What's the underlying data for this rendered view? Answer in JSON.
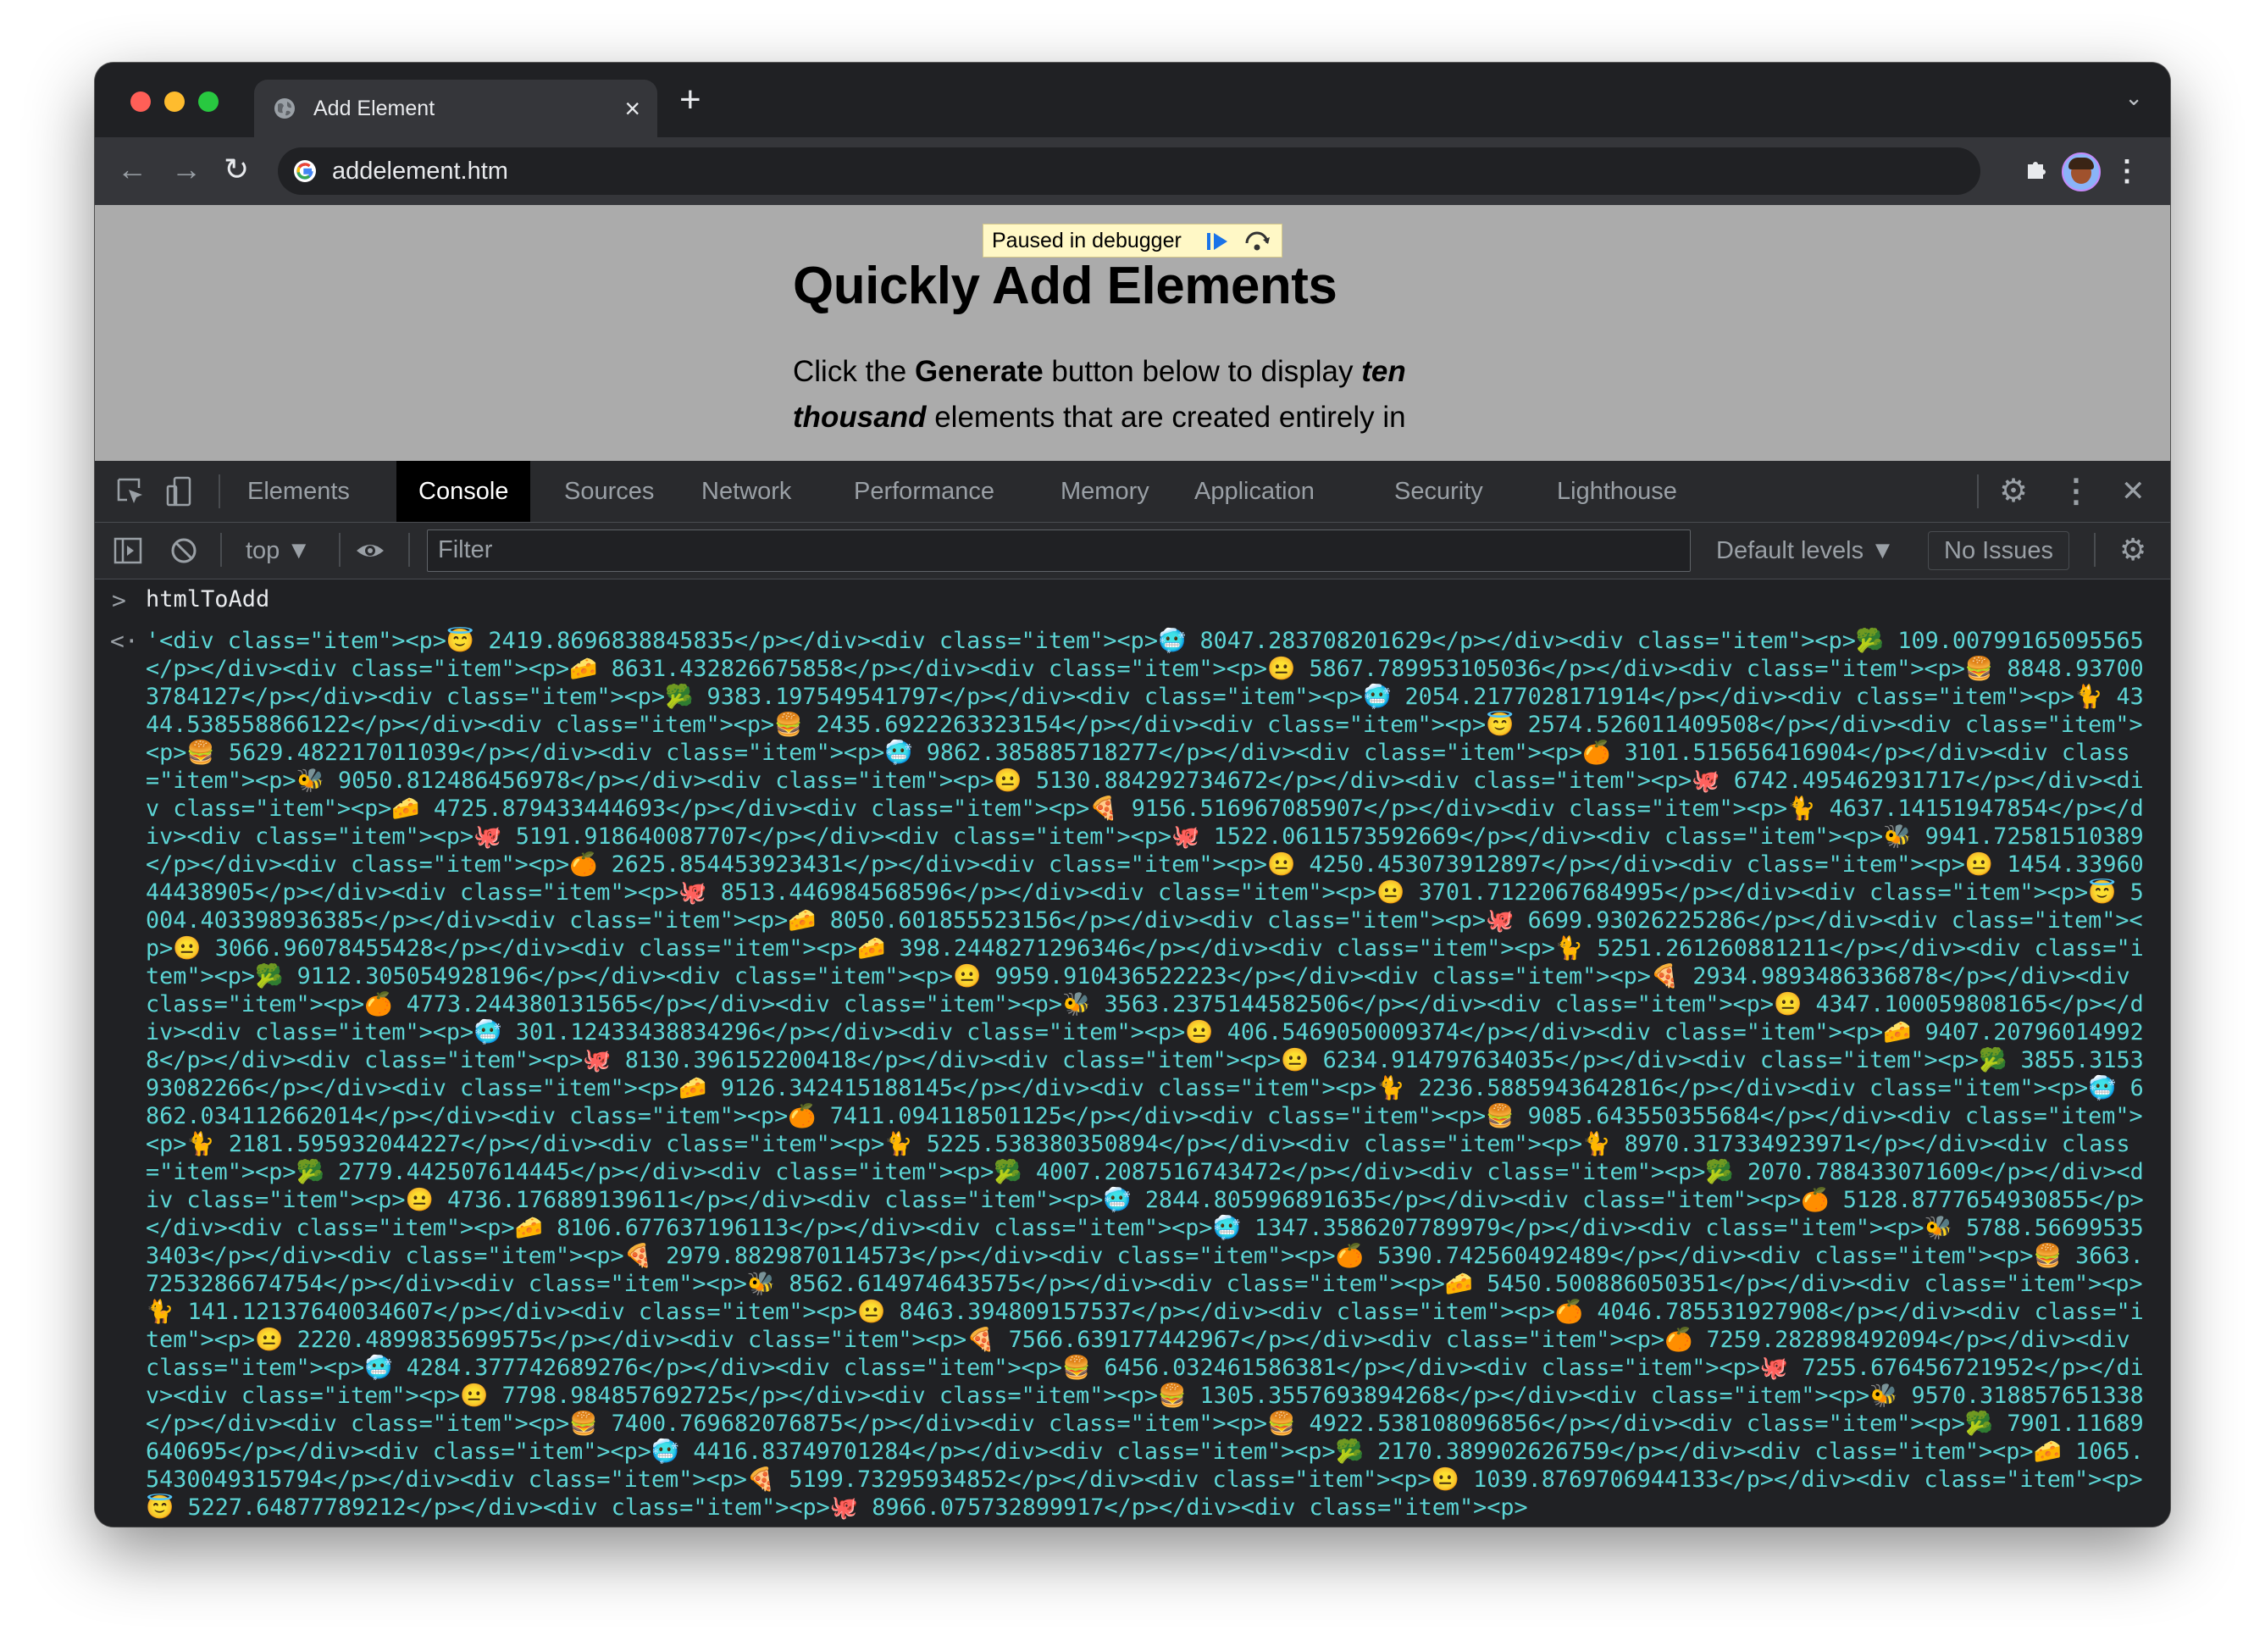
{
  "browser": {
    "tab_title": "Add Element",
    "tab_close": "×",
    "new_tab": "+",
    "tab_search": "⌄",
    "url": "addelement.htm",
    "nav_back": "←",
    "nav_forward": "→",
    "nav_reload": "↻",
    "menu": "⋮"
  },
  "page": {
    "debugger_banner": "Paused in debugger",
    "title": "Quickly Add Elements",
    "para_prefix": "Click the ",
    "para_bold": "Generate",
    "para_mid": " button below to display ",
    "para_em": "ten thousand",
    "para_suffix": " elements that are created entirely in"
  },
  "devtools": {
    "tabs": [
      "Elements",
      "Console",
      "Sources",
      "Network",
      "Performance",
      "Memory",
      "Application",
      "Security",
      "Lighthouse"
    ],
    "active_tab": "Console",
    "settings": "⚙",
    "more": "⋮",
    "close": "✕",
    "context": "top ▼",
    "filter_placeholder": "Filter",
    "levels": "Default levels ▼",
    "issues": "No Issues"
  },
  "console": {
    "input_prompt": ">",
    "input_command": "htmlToAdd",
    "output_prompt": "<·",
    "output_text": "'<div class=\"item\"><p>😇 2419.8696838845835</p></div><div class=\"item\"><p>🥶 8047.283708201629</p></div><div class=\"item\"><p>🥦 109.00799165095565</p></div><div class=\"item\"><p>🧀 8631.432826675858</p></div><div class=\"item\"><p>😐 5867.789953105036</p></div><div class=\"item\"><p>🍔 8848.937003784127</p></div><div class=\"item\"><p>🥦 9383.197549541797</p></div><div class=\"item\"><p>🥶 2054.2177028171914</p></div><div class=\"item\"><p>🐈 4344.538558866122</p></div><div class=\"item\"><p>🍔 2435.6922263323154</p></div><div class=\"item\"><p>😇 2574.526011409508</p></div><div class=\"item\"><p>🍔 5629.482217011039</p></div><div class=\"item\"><p>🥶 9862.385885718277</p></div><div class=\"item\"><p>🍊 3101.515656416904</p></div><div class=\"item\"><p>🐝 9050.812486456978</p></div><div class=\"item\"><p>😐 5130.884292734672</p></div><div class=\"item\"><p>🐙 6742.495462931717</p></div><div class=\"item\"><p>🧀 4725.879433444693</p></div><div class=\"item\"><p>🍕 9156.516967085907</p></div><div class=\"item\"><p>🐈 4637.14151947854</p></div><div class=\"item\"><p>🐙 5191.918640087707</p></div><div class=\"item\"><p>🐙 1522.0611573592669</p></div><div class=\"item\"><p>🐝 9941.72581510389</p></div><div class=\"item\"><p>🍊 2625.854453923431</p></div><div class=\"item\"><p>😐 4250.453073912897</p></div><div class=\"item\"><p>😐 1454.3396044438905</p></div><div class=\"item\"><p>🐙 8513.446984568596</p></div><div class=\"item\"><p>😐 3701.7122067684995</p></div><div class=\"item\"><p>😇 5004.403398936385</p></div><div class=\"item\"><p>🧀 8050.601855523156</p></div><div class=\"item\"><p>🐙 6699.93026225286</p></div><div class=\"item\"><p>😐 3066.96078455428</p></div><div class=\"item\"><p>🧀 398.2448271296346</p></div><div class=\"item\"><p>🐈 5251.261260881211</p></div><div class=\"item\"><p>🥦 9112.305054928196</p></div><div class=\"item\"><p>😐 9959.910436522223</p></div><div class=\"item\"><p>🍕 2934.9893486336878</p></div><div class=\"item\"><p>🍊 4773.244380131565</p></div><div class=\"item\"><p>🐝 3563.2375144582506</p></div><div class=\"item\"><p>😐 4347.100059808165</p></div><div class=\"item\"><p>🥶 301.12433438834296</p></div><div class=\"item\"><p>😐 406.5469050009374</p></div><div class=\"item\"><p>🧀 9407.207960149928</p></div><div class=\"item\"><p>🐙 8130.396152200418</p></div><div class=\"item\"><p>😐 6234.914797634035</p></div><div class=\"item\"><p>🥦 3855.315393082266</p></div><div class=\"item\"><p>🧀 9126.342415188145</p></div><div class=\"item\"><p>🐈 2236.5885943642816</p></div><div class=\"item\"><p>🥶 6862.034112662014</p></div><div class=\"item\"><p>🍊 7411.094118501125</p></div><div class=\"item\"><p>🍔 9085.643550355684</p></div><div class=\"item\"><p>🐈 2181.595932044227</p></div><div class=\"item\"><p>🐈 5225.538380350894</p></div><div class=\"item\"><p>🐈 8970.317334923971</p></div><div class=\"item\"><p>🥦 2779.442507614445</p></div><div class=\"item\"><p>🥦 4007.2087516743472</p></div><div class=\"item\"><p>🥦 2070.788433071609</p></div><div class=\"item\"><p>😐 4736.176889139611</p></div><div class=\"item\"><p>🥶 2844.805996891635</p></div><div class=\"item\"><p>🍊 5128.8777654930855</p></div><div class=\"item\"><p>🧀 8106.677637196113</p></div><div class=\"item\"><p>🥶 1347.3586207789979</p></div><div class=\"item\"><p>🐝 5788.566995353403</p></div><div class=\"item\"><p>🍕 2979.8829870114573</p></div><div class=\"item\"><p>🍊 5390.742560492489</p></div><div class=\"item\"><p>🍔 3663.7253286674754</p></div><div class=\"item\"><p>🐝 8562.614974643575</p></div><div class=\"item\"><p>🧀 5450.500886050351</p></div><div class=\"item\"><p>🐈 141.12137640034607</p></div><div class=\"item\"><p>😐 8463.394809157537</p></div><div class=\"item\"><p>🍊 4046.785531927908</p></div><div class=\"item\"><p>😐 2220.4899835699575</p></div><div class=\"item\"><p>🍕 7566.639177442967</p></div><div class=\"item\"><p>🍊 7259.282898492094</p></div><div class=\"item\"><p>🥶 4284.377742689276</p></div><div class=\"item\"><p>🍔 6456.032461586381</p></div><div class=\"item\"><p>🐙 7255.676456721952</p></div><div class=\"item\"><p>😐 7798.984857692725</p></div><div class=\"item\"><p>🍔 1305.3557693894268</p></div><div class=\"item\"><p>🐝 9570.318857651338</p></div><div class=\"item\"><p>🍔 7400.769682076875</p></div><div class=\"item\"><p>🍔 4922.538108096856</p></div><div class=\"item\"><p>🥦 7901.11689640695</p></div><div class=\"item\"><p>🥶 4416.83749701284</p></div><div class=\"item\"><p>🥦 2170.389902626759</p></div><div class=\"item\"><p>🧀 1065.5430049315794</p></div><div class=\"item\"><p>🍕 5199.73295934852</p></div><div class=\"item\"><p>😐 1039.8769706944133</p></div><div class=\"item\"><p>😇 5227.64877789212</p></div><div class=\"item\"><p>🐙 8966.075732899917</p></div><div class=\"item\"><p>"
  },
  "colors": {
    "output_text": "#5cd5d5",
    "active_tab_bg": "#000000",
    "page_bg": "#ababab",
    "banner_bg": "#fff8c6"
  },
  "icons": [
    "globe-icon",
    "google-icon",
    "extensions-icon",
    "avatar",
    "inspect-icon",
    "device-toggle-icon",
    "sidebar-toggle-icon",
    "clear-console-icon",
    "eye-icon",
    "resume-icon",
    "step-over-icon",
    "gear-icon"
  ]
}
